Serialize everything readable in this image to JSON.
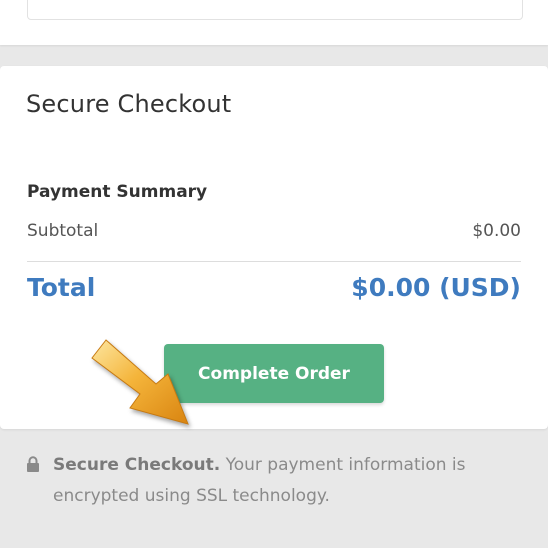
{
  "checkout": {
    "title": "Secure Checkout",
    "summary_heading": "Payment Summary",
    "subtotal_label": "Subtotal",
    "subtotal_value": "$0.00",
    "total_label": "Total",
    "total_value": "$0.00 (USD)",
    "complete_button_label": "Complete Order"
  },
  "footer": {
    "lock_icon": "lock-icon",
    "strong_text": "Secure Checkout.",
    "line1_rest": " Your payment information is",
    "line2": "encrypted using SSL technology."
  },
  "colors": {
    "accent_blue": "#3f7bbf",
    "button_green": "#56b183",
    "annotation_arrow": "#f0a021"
  }
}
